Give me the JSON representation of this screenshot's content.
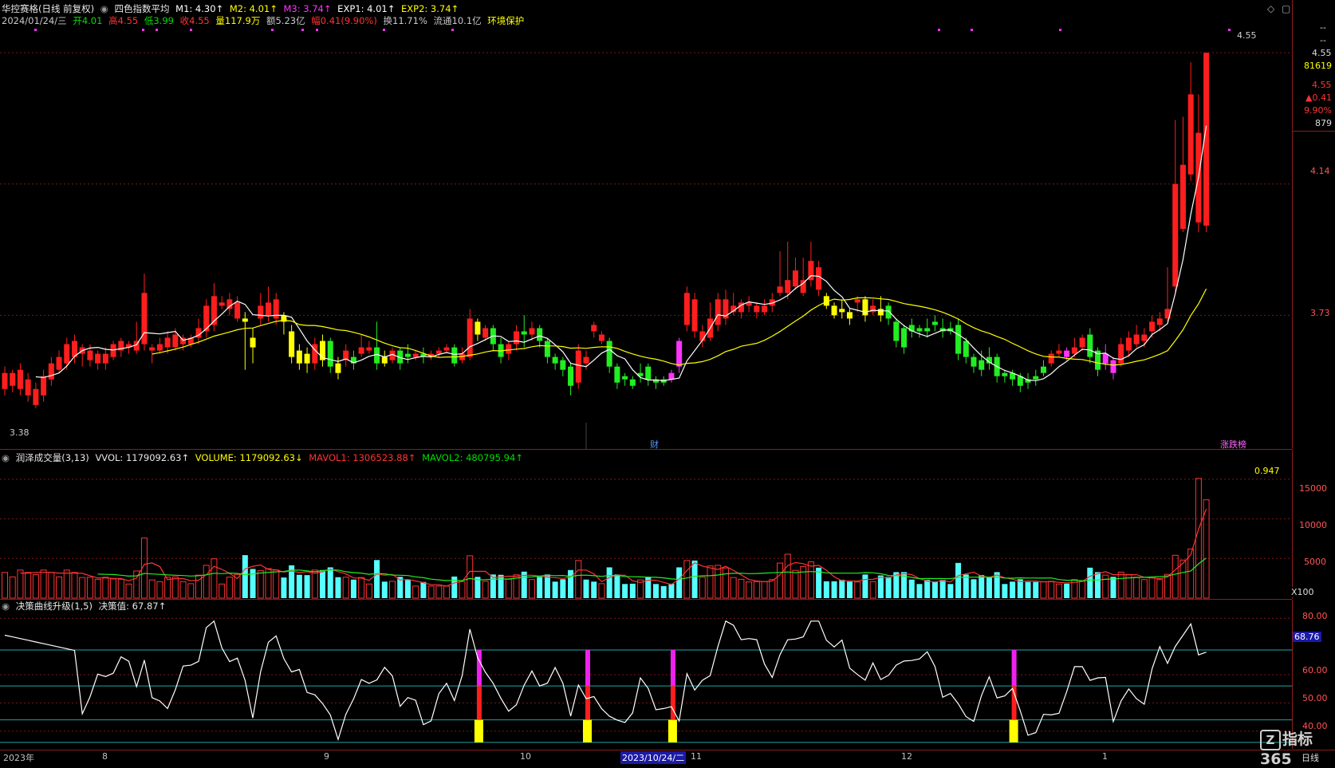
{
  "header": {
    "stock_name": "华控赛格(日线 前复权)",
    "indicator_name": "四色指数平均",
    "m1": "M1: 4.30↑",
    "m2": "M2: 4.01↑",
    "m3": "M3: 3.74↑",
    "exp1": "EXP1: 4.01↑",
    "exp2": "EXP2: 3.74↑",
    "colors": {
      "m1": "#ffffff",
      "m2": "#ffff00",
      "m3": "#ff33ff",
      "exp1": "#ffffff",
      "exp2": "#ffff00",
      "arrow_up": "#ff3333"
    }
  },
  "quote": {
    "date": "2024/01/24/三",
    "open": "开4.01",
    "high": "高4.55",
    "low": "低3.99",
    "close": "收4.55",
    "volume": "量117.9万",
    "amount": "额5.23亿",
    "change": "幅0.41(9.90%)",
    "turnover": "换11.71%",
    "float": "流通10.1亿",
    "tag": "环境保护"
  },
  "price_panel": {
    "axis_ticks": [
      "4.55",
      "4.14",
      "3.73"
    ],
    "side_values": [
      "--",
      "--",
      "4.55",
      "81619",
      "4.55",
      "▲0.41",
      "9.90%",
      "879"
    ],
    "high_marker": "4.55",
    "low_marker": "3.38",
    "event_labels": [
      "财",
      "涨跌榜"
    ]
  },
  "volume_panel": {
    "title": "润泽成交量(3,13)",
    "vvol": "VVOL: 1179092.63↑",
    "volume": "VOLUME: 1179092.63↓",
    "mavol1": "MAVOL1: 1306523.88↑",
    "mavol2": "MAVOL2: 480795.94↑",
    "ratio": "0.947",
    "axis_ticks": [
      "15000",
      "10000",
      "5000"
    ],
    "unit": "X100"
  },
  "decision_panel": {
    "title": "决策曲线升级(1,5)",
    "value": "决策值: 67.87↑",
    "axis_ticks": [
      "80.00",
      "60.00",
      "50.00",
      "40.00"
    ],
    "current_value": "68.76"
  },
  "date_axis": {
    "labels": [
      "2023年",
      "8",
      "9",
      "10",
      "2023/10/24/二",
      "11",
      "12",
      "1"
    ],
    "period": "日线"
  },
  "logo": {
    "text": "指标365",
    "mark": "Z"
  },
  "chart_data": {
    "type": "candlestick",
    "title": "华控赛格(日线 前复权)",
    "last": {
      "open": 4.01,
      "high": 4.55,
      "low": 3.99,
      "close": 4.55
    },
    "y_ticks": [
      4.55,
      4.14,
      3.73
    ],
    "candles": [
      [
        3.5,
        3.55,
        3.48,
        3.57,
        "r"
      ],
      [
        3.51,
        3.55,
        3.49,
        3.56,
        "r"
      ],
      [
        3.5,
        3.56,
        3.48,
        3.58,
        "r"
      ],
      [
        3.48,
        3.53,
        3.46,
        3.55,
        "r"
      ],
      [
        3.45,
        3.5,
        3.44,
        3.52,
        "r"
      ],
      [
        3.48,
        3.54,
        3.46,
        3.56,
        "r"
      ],
      [
        3.53,
        3.58,
        3.51,
        3.6,
        "r"
      ],
      [
        3.56,
        3.6,
        3.55,
        3.62,
        "r"
      ],
      [
        3.58,
        3.64,
        3.56,
        3.66,
        "r"
      ],
      [
        3.6,
        3.65,
        3.58,
        3.67,
        "r"
      ],
      [
        3.61,
        3.63,
        3.57,
        3.64,
        "r"
      ],
      [
        3.59,
        3.62,
        3.57,
        3.64,
        "r"
      ],
      [
        3.58,
        3.61,
        3.56,
        3.62,
        "r"
      ],
      [
        3.58,
        3.61,
        3.56,
        3.63,
        "r"
      ],
      [
        3.6,
        3.64,
        3.59,
        3.65,
        "r"
      ],
      [
        3.62,
        3.65,
        3.6,
        3.66,
        "r"
      ],
      [
        3.63,
        3.64,
        3.61,
        3.65,
        "r"
      ],
      [
        3.62,
        3.65,
        3.61,
        3.71,
        "r"
      ],
      [
        3.64,
        3.8,
        3.62,
        3.86,
        "r"
      ],
      [
        3.62,
        3.63,
        3.58,
        3.64,
        "r"
      ],
      [
        3.62,
        3.64,
        3.61,
        3.66,
        "r"
      ],
      [
        3.63,
        3.66,
        3.61,
        3.68,
        "r"
      ],
      [
        3.63,
        3.67,
        3.62,
        3.69,
        "r"
      ],
      [
        3.64,
        3.66,
        3.62,
        3.67,
        "r"
      ],
      [
        3.64,
        3.66,
        3.63,
        3.67,
        "r"
      ],
      [
        3.66,
        3.69,
        3.64,
        3.72,
        "r"
      ],
      [
        3.68,
        3.76,
        3.66,
        3.78,
        "r"
      ],
      [
        3.7,
        3.79,
        3.68,
        3.83,
        "r"
      ],
      [
        3.76,
        3.77,
        3.75,
        3.79,
        "r"
      ],
      [
        3.75,
        3.78,
        3.73,
        3.8,
        "r"
      ],
      [
        3.72,
        3.77,
        3.71,
        3.79,
        "r"
      ],
      [
        3.72,
        3.71,
        3.56,
        3.74,
        "y"
      ],
      [
        3.66,
        3.63,
        3.58,
        3.69,
        "y"
      ],
      [
        3.72,
        3.76,
        3.7,
        3.8,
        "r"
      ],
      [
        3.73,
        3.77,
        3.71,
        3.82,
        "r"
      ],
      [
        3.72,
        3.78,
        3.7,
        3.8,
        "r"
      ],
      [
        3.73,
        3.71,
        3.67,
        3.74,
        "y"
      ],
      [
        3.68,
        3.6,
        3.58,
        3.7,
        "y"
      ],
      [
        3.62,
        3.58,
        3.56,
        3.64,
        "y"
      ],
      [
        3.61,
        3.58,
        3.55,
        3.63,
        "y"
      ],
      [
        3.58,
        3.64,
        3.56,
        3.66,
        "r"
      ],
      [
        3.65,
        3.59,
        3.57,
        3.67,
        "y"
      ],
      [
        3.65,
        3.57,
        3.55,
        3.66,
        "g"
      ],
      [
        3.58,
        3.55,
        3.53,
        3.6,
        "y"
      ],
      [
        3.59,
        3.62,
        3.57,
        3.64,
        "r"
      ],
      [
        3.6,
        3.58,
        3.56,
        3.62,
        "g"
      ],
      [
        3.61,
        3.63,
        3.6,
        3.67,
        "r"
      ],
      [
        3.62,
        3.63,
        3.61,
        3.65,
        "r"
      ],
      [
        3.63,
        3.58,
        3.56,
        3.71,
        "g"
      ],
      [
        3.6,
        3.58,
        3.57,
        3.62,
        "y"
      ],
      [
        3.59,
        3.62,
        3.58,
        3.63,
        "r"
      ],
      [
        3.62,
        3.58,
        3.56,
        3.63,
        "g"
      ],
      [
        3.61,
        3.6,
        3.58,
        3.64,
        "g"
      ],
      [
        3.6,
        3.61,
        3.59,
        3.62,
        "r"
      ],
      [
        3.61,
        3.6,
        3.58,
        3.63,
        "g"
      ],
      [
        3.6,
        3.61,
        3.59,
        3.62,
        "r"
      ],
      [
        3.61,
        3.62,
        3.6,
        3.63,
        "r"
      ],
      [
        3.62,
        3.63,
        3.61,
        3.64,
        "r"
      ],
      [
        3.63,
        3.58,
        3.57,
        3.64,
        "g"
      ],
      [
        3.59,
        3.61,
        3.58,
        3.63,
        "r"
      ],
      [
        3.6,
        3.72,
        3.59,
        3.75,
        "r"
      ],
      [
        3.71,
        3.67,
        3.65,
        3.72,
        "y"
      ],
      [
        3.66,
        3.69,
        3.65,
        3.7,
        "r"
      ],
      [
        3.69,
        3.64,
        3.62,
        3.7,
        "g"
      ],
      [
        3.64,
        3.6,
        3.58,
        3.66,
        "g"
      ],
      [
        3.61,
        3.64,
        3.59,
        3.65,
        "r"
      ],
      [
        3.64,
        3.68,
        3.62,
        3.7,
        "r"
      ],
      [
        3.68,
        3.67,
        3.63,
        3.73,
        "g"
      ],
      [
        3.67,
        3.69,
        3.65,
        3.71,
        "r"
      ],
      [
        3.69,
        3.65,
        3.63,
        3.7,
        "g"
      ],
      [
        3.65,
        3.6,
        3.58,
        3.66,
        "g"
      ],
      [
        3.6,
        3.58,
        3.56,
        3.61,
        "g"
      ],
      [
        3.59,
        3.56,
        3.54,
        3.6,
        "g"
      ],
      [
        3.57,
        3.51,
        3.48,
        3.58,
        "g"
      ],
      [
        3.52,
        3.62,
        3.5,
        3.64,
        "r"
      ],
      [
        3.6,
        3.58,
        3.56,
        3.62,
        "r"
      ],
      [
        3.7,
        3.68,
        3.66,
        3.71,
        "r"
      ],
      [
        3.65,
        3.67,
        3.64,
        3.68,
        "r"
      ],
      [
        3.65,
        3.57,
        3.55,
        3.66,
        "g"
      ],
      [
        3.57,
        3.52,
        3.5,
        3.58,
        "g"
      ],
      [
        3.54,
        3.53,
        3.51,
        3.55,
        "g"
      ],
      [
        3.53,
        3.51,
        3.5,
        3.54,
        "g"
      ],
      [
        3.54,
        3.55,
        3.52,
        3.58,
        "g"
      ],
      [
        3.57,
        3.53,
        3.51,
        3.58,
        "g"
      ],
      [
        3.53,
        3.52,
        3.5,
        3.54,
        "g"
      ],
      [
        3.53,
        3.52,
        3.51,
        3.54,
        "g"
      ],
      [
        3.55,
        3.53,
        3.52,
        3.56,
        "m"
      ],
      [
        3.65,
        3.57,
        3.55,
        3.66,
        "m"
      ],
      [
        3.7,
        3.8,
        3.68,
        3.82,
        "r"
      ],
      [
        3.78,
        3.68,
        3.66,
        3.8,
        "r"
      ],
      [
        3.65,
        3.68,
        3.63,
        3.7,
        "r"
      ],
      [
        3.66,
        3.72,
        3.65,
        3.77,
        "r"
      ],
      [
        3.7,
        3.78,
        3.68,
        3.8,
        "r"
      ],
      [
        3.72,
        3.78,
        3.7,
        3.81,
        "r"
      ],
      [
        3.74,
        3.76,
        3.73,
        3.8,
        "r"
      ],
      [
        3.74,
        3.77,
        3.72,
        3.78,
        "r"
      ],
      [
        3.76,
        3.77,
        3.74,
        3.79,
        "r"
      ],
      [
        3.74,
        3.76,
        3.72,
        3.77,
        "r"
      ],
      [
        3.74,
        3.76,
        3.73,
        3.78,
        "r"
      ],
      [
        3.76,
        3.78,
        3.74,
        3.8,
        "r"
      ],
      [
        3.8,
        3.82,
        3.79,
        3.93,
        "r"
      ],
      [
        3.8,
        3.84,
        3.78,
        3.96,
        "r"
      ],
      [
        3.82,
        3.87,
        3.81,
        3.91,
        "r"
      ],
      [
        3.8,
        3.84,
        3.79,
        3.91,
        "r"
      ],
      [
        3.84,
        3.9,
        3.82,
        3.96,
        "r"
      ],
      [
        3.88,
        3.81,
        3.79,
        3.9,
        "r"
      ],
      [
        3.79,
        3.76,
        3.75,
        3.8,
        "y"
      ],
      [
        3.76,
        3.73,
        3.72,
        3.77,
        "y"
      ],
      [
        3.75,
        3.74,
        3.72,
        3.78,
        "y"
      ],
      [
        3.74,
        3.72,
        3.7,
        3.75,
        "y"
      ],
      [
        3.77,
        3.78,
        3.74,
        3.79,
        "r"
      ],
      [
        3.78,
        3.73,
        3.71,
        3.79,
        "y"
      ],
      [
        3.74,
        3.76,
        3.73,
        3.78,
        "r"
      ],
      [
        3.75,
        3.73,
        3.71,
        3.79,
        "y"
      ],
      [
        3.76,
        3.72,
        3.7,
        3.77,
        "g"
      ],
      [
        3.71,
        3.65,
        3.63,
        3.72,
        "g"
      ],
      [
        3.69,
        3.63,
        3.61,
        3.7,
        "g"
      ],
      [
        3.7,
        3.68,
        3.66,
        3.72,
        "g"
      ],
      [
        3.69,
        3.68,
        3.66,
        3.7,
        "g"
      ],
      [
        3.69,
        3.68,
        3.66,
        3.72,
        "g"
      ],
      [
        3.71,
        3.7,
        3.68,
        3.73,
        "g"
      ],
      [
        3.69,
        3.68,
        3.66,
        3.72,
        "g"
      ],
      [
        3.69,
        3.68,
        3.67,
        3.71,
        "g"
      ],
      [
        3.7,
        3.61,
        3.59,
        3.72,
        "g"
      ],
      [
        3.65,
        3.6,
        3.58,
        3.66,
        "g"
      ],
      [
        3.6,
        3.57,
        3.55,
        3.61,
        "g"
      ],
      [
        3.59,
        3.56,
        3.54,
        3.62,
        "g"
      ],
      [
        3.6,
        3.58,
        3.56,
        3.63,
        "g"
      ],
      [
        3.6,
        3.54,
        3.52,
        3.61,
        "g"
      ],
      [
        3.55,
        3.54,
        3.52,
        3.56,
        "g"
      ],
      [
        3.55,
        3.53,
        3.51,
        3.56,
        "g"
      ],
      [
        3.54,
        3.51,
        3.49,
        3.55,
        "g"
      ],
      [
        3.53,
        3.52,
        3.5,
        3.55,
        "g"
      ],
      [
        3.54,
        3.53,
        3.51,
        3.56,
        "g"
      ],
      [
        3.55,
        3.57,
        3.54,
        3.59,
        "g"
      ],
      [
        3.58,
        3.61,
        3.57,
        3.62,
        "r"
      ],
      [
        3.61,
        3.62,
        3.6,
        3.64,
        "r"
      ],
      [
        3.62,
        3.6,
        3.59,
        3.63,
        "m"
      ],
      [
        3.61,
        3.63,
        3.6,
        3.66,
        "r"
      ],
      [
        3.63,
        3.66,
        3.62,
        3.67,
        "r"
      ],
      [
        3.67,
        3.6,
        3.58,
        3.69,
        "g"
      ],
      [
        3.62,
        3.56,
        3.54,
        3.63,
        "g"
      ],
      [
        3.58,
        3.61,
        3.56,
        3.64,
        "m"
      ],
      [
        3.59,
        3.55,
        3.53,
        3.6,
        "m"
      ],
      [
        3.58,
        3.64,
        3.57,
        3.66,
        "r"
      ],
      [
        3.62,
        3.66,
        3.6,
        3.68,
        "r"
      ],
      [
        3.64,
        3.67,
        3.63,
        3.7,
        "r"
      ],
      [
        3.65,
        3.67,
        3.63,
        3.69,
        "r"
      ],
      [
        3.68,
        3.71,
        3.66,
        3.73,
        "r"
      ],
      [
        3.7,
        3.72,
        3.68,
        3.74,
        "r"
      ],
      [
        3.72,
        3.75,
        3.71,
        3.88,
        "r"
      ],
      [
        3.82,
        4.14,
        3.8,
        4.34,
        "r"
      ],
      [
        4.0,
        4.2,
        3.99,
        4.35,
        "r"
      ],
      [
        4.17,
        4.42,
        4.15,
        4.52,
        "r"
      ],
      [
        4.02,
        4.3,
        3.99,
        4.42,
        "r"
      ],
      [
        4.01,
        4.55,
        3.99,
        4.55,
        "r"
      ]
    ],
    "ma_series": [
      {
        "name": "M1",
        "color": "#ffffff"
      },
      {
        "name": "M2",
        "color": "#ffff00"
      }
    ],
    "volume_series": {
      "unit": "X100",
      "y_ticks": [
        15000,
        10000,
        5000
      ],
      "last_value": 1179092.63
    },
    "decision_series": {
      "y_ticks": [
        80.0,
        60.0,
        50.0,
        40.0
      ],
      "last_value": 67.87,
      "current_value": 68.76
    }
  }
}
